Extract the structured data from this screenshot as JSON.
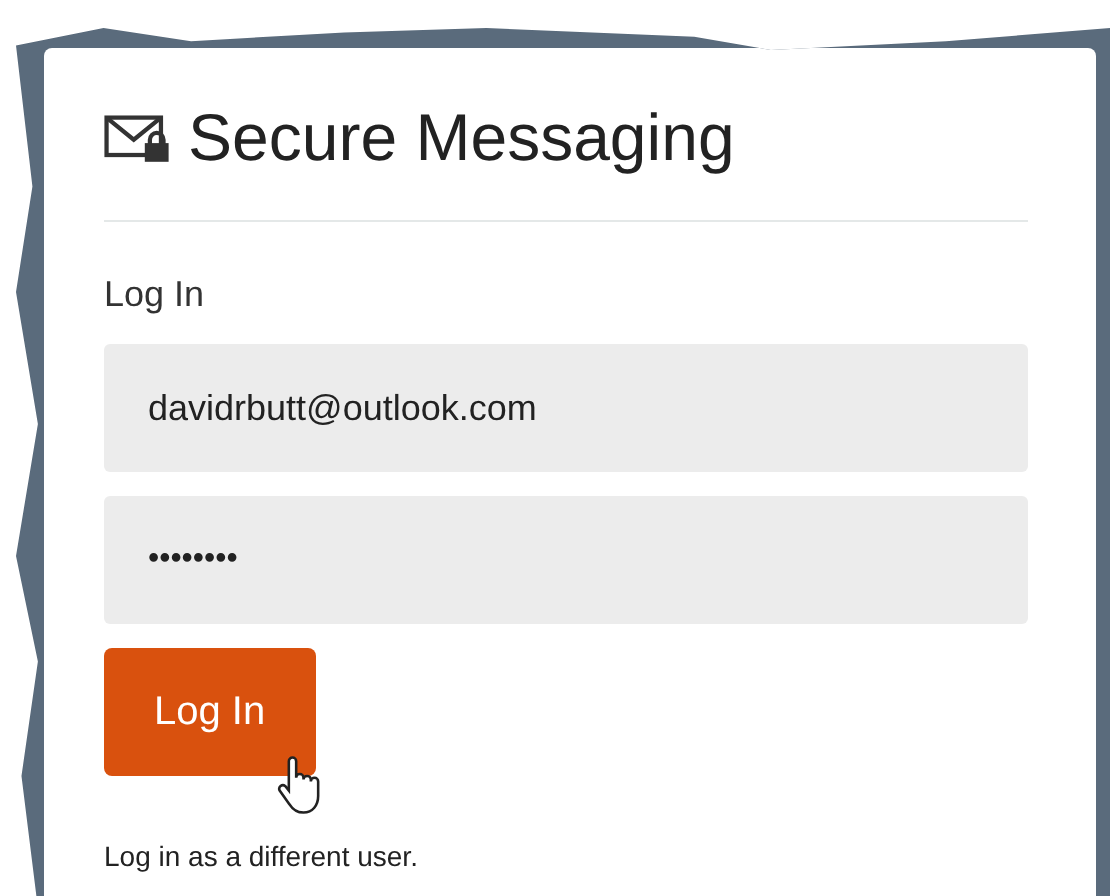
{
  "title": "Secure Messaging",
  "form_label": "Log In",
  "fields": [
    {
      "kind": "email",
      "value": "davidrbutt@outlook.com"
    },
    {
      "kind": "password",
      "value": "••••••••"
    }
  ],
  "submit_button": "Log In",
  "link": "Log in as a different user."
}
